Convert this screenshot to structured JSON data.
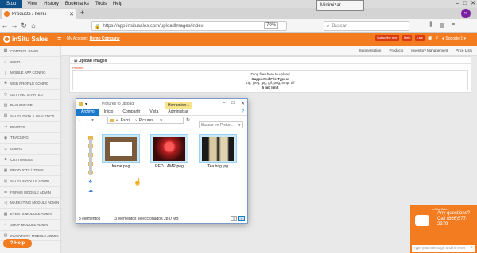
{
  "browser": {
    "stop_label": "Stop",
    "menu": [
      "View",
      "History",
      "Bookmarks",
      "Tools",
      "Help"
    ],
    "tooltip": "Minimizar",
    "tab_title": "Products / Items",
    "url": "https://app.insitusales.com/uploadImages/index",
    "zoom": "70%",
    "search_placeholder": "Buscar"
  },
  "app": {
    "logo_text": "inSitu Sales",
    "account_prefix": "My Account:",
    "account_name": "Demo Company",
    "badges": [
      "Subscribe now",
      "Help",
      "Live"
    ],
    "support": "Soporte 1"
  },
  "sidebar": {
    "items": [
      {
        "label": "CONTROL PANEL",
        "icon": "dashboard-icon"
      },
      {
        "label": "INSITU",
        "icon": "home-icon"
      },
      {
        "label": "MOBILE APP CONFIG",
        "icon": "mobile-icon"
      },
      {
        "label": "WEB PROFILE CONFIG",
        "icon": "gear-icon"
      },
      {
        "label": "GETTING STARTED",
        "icon": "clock-icon"
      },
      {
        "label": "DASHBOARD",
        "icon": "chart-icon"
      },
      {
        "label": "SALES DATA & ANALYTICS",
        "icon": "stats-icon"
      },
      {
        "label": "ROUTES",
        "icon": "route-icon"
      },
      {
        "label": "TRACKING",
        "icon": "pin-icon"
      },
      {
        "label": "USERS",
        "icon": "user-icon"
      },
      {
        "label": "CUSTOMERS",
        "icon": "customer-icon"
      },
      {
        "label": "PRODUCTS / ITEMS",
        "icon": "box-icon"
      },
      {
        "label": "SALES MODULE ADMIN",
        "icon": "cart-icon"
      },
      {
        "label": "FORMS MODULE ADMIN",
        "icon": "form-icon"
      },
      {
        "label": "MARKETING MODULE ADMIN",
        "icon": "megaphone-icon"
      },
      {
        "label": "EVENTS MODULE ADMIN",
        "icon": "calendar-icon"
      },
      {
        "label": "SHOP MODULE ADMIN",
        "icon": "shop-icon"
      },
      {
        "label": "INVENTORY MODULE ADMIN",
        "icon": "inventory-icon"
      }
    ],
    "help_label": "Help"
  },
  "subnav": [
    "Segmentation",
    "Products",
    "Inventory Management",
    "Price Lists"
  ],
  "upload": {
    "title": "Upload Images",
    "picture_label": "Pictures",
    "drop_line1": "Drop files here to upload",
    "drop_line2": "Supported File Types:",
    "drop_line3": "zip, jpeg, jpg, gif, png, bmp, tiff",
    "drop_line4": "5 mb limit"
  },
  "dialog": {
    "title": "Pictures to upload",
    "tools_tab": "Herramien...",
    "ribbon": [
      "Archivo",
      "Inicio",
      "Compartir",
      "Vista",
      "Administrar"
    ],
    "path": [
      "Escri...",
      "Pictures ..."
    ],
    "search_placeholder": "Buscar en Pictur...",
    "files": [
      {
        "name": "frame.png"
      },
      {
        "name": "RED LAMP.jpeg"
      },
      {
        "name": "Tea bag.jpg"
      }
    ],
    "status_count": "3 elementos",
    "status_selected": "3 elementos seleccionados  28,0 MB"
  },
  "chat": {
    "top": "InSitu Sales",
    "line1": "Any questions? Call (866)577-2379",
    "input_placeholder": "Type your message and hit enter"
  }
}
